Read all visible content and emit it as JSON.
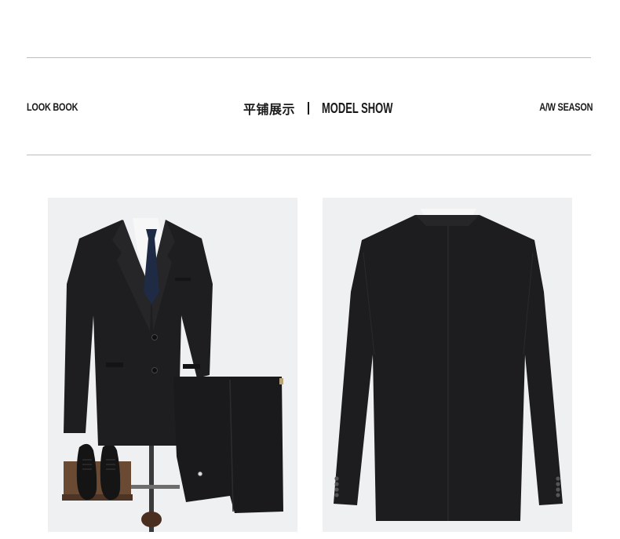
{
  "header": {
    "left_label": "LOOK BOOK",
    "title_cn": "平铺展示",
    "title_en": "MODEL SHOW",
    "right_label": "A/W SEASON"
  },
  "photos": [
    {
      "name": "suit-front-photo",
      "view": "front"
    },
    {
      "name": "suit-back-photo",
      "view": "back"
    }
  ],
  "colors": {
    "rule": "#bdbdbd",
    "photo_background": "#eef0f2",
    "suit": "#1d1d1f",
    "tie": "#1f2a44",
    "shoes": "#151515",
    "wood_stand": "#5a3d2a"
  }
}
